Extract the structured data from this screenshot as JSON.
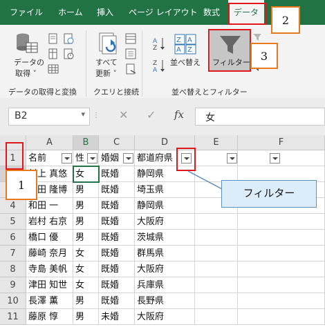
{
  "ribbon": {
    "tabs": [
      {
        "label": "ファイル",
        "active": false
      },
      {
        "label": "ホーム",
        "active": false
      },
      {
        "label": "挿入",
        "active": false
      },
      {
        "label": "ページ レイアウト",
        "active": false
      },
      {
        "label": "数式",
        "active": false
      },
      {
        "label": "データ",
        "active": true
      }
    ],
    "get_data_line1": "データの",
    "get_data_line2": "取得 ˅",
    "refresh_line1": "すべて",
    "refresh_line2": "更新 ˅",
    "sort_label": "並べ替え",
    "filter_label": "フィルター",
    "group_get": "データの取得と変換",
    "group_query": "クエリと接続",
    "group_sort": "並べ替えとフィルター"
  },
  "formula_bar": {
    "name_box": "B2",
    "fx": "fx",
    "cancel": "✕",
    "enter": "✓",
    "content": "女"
  },
  "sheet": {
    "columns": [
      "A",
      "B",
      "C",
      "D",
      "E",
      "F"
    ],
    "row_numbers": [
      "1",
      "2",
      "3",
      "4",
      "5",
      "6",
      "7",
      "8",
      "9",
      "10",
      "11"
    ],
    "header": [
      "名前",
      "性",
      "婚姻",
      "都道府県"
    ],
    "rows": [
      [
        "村上 真悠",
        "女",
        "既婚",
        "静岡県"
      ],
      [
        "坂田 隆博",
        "男",
        "既婚",
        "埼玉県"
      ],
      [
        "和田 一",
        "男",
        "既婚",
        "静岡県"
      ],
      [
        "岩村 右京",
        "男",
        "既婚",
        "大阪府"
      ],
      [
        "橋口 優",
        "男",
        "既婚",
        "茨城県"
      ],
      [
        "藤崎 奈月",
        "女",
        "既婚",
        "群馬県"
      ],
      [
        "寺島 美帆",
        "女",
        "既婚",
        "大阪府"
      ],
      [
        "津田 知世",
        "女",
        "既婚",
        "兵庫県"
      ],
      [
        "長澤 薫",
        "男",
        "既婚",
        "長野県"
      ],
      [
        "藤原 惇",
        "男",
        "未婚",
        "大阪府"
      ]
    ]
  },
  "annotations": {
    "callout_text": "フィルター",
    "step1": "1",
    "step2": "2",
    "step3": "3"
  },
  "colors": {
    "excel_green": "#217346",
    "highlight_red": "#e0161b",
    "step_orange": "#e87a1e",
    "callout_fill": "#dcecf8"
  }
}
